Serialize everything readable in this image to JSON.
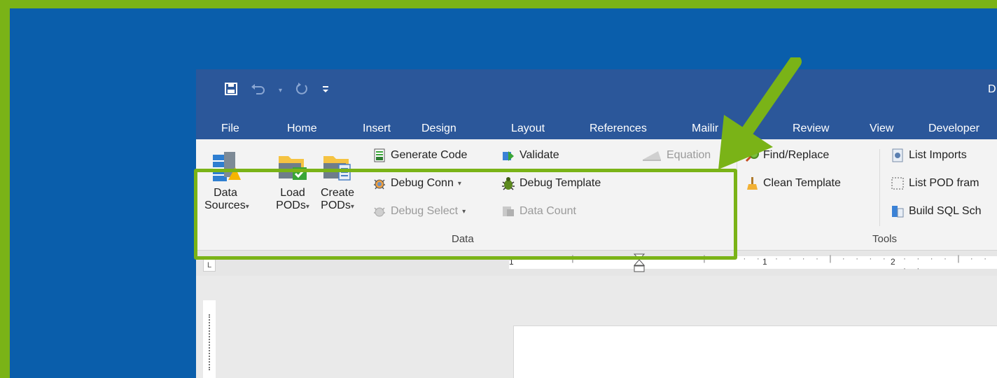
{
  "titlebar": {
    "doc_title_partial": "D"
  },
  "tabs": [
    "File",
    "Home",
    "Insert",
    "Design",
    "Layout",
    "References",
    "Mailir",
    "Review",
    "View",
    "Developer"
  ],
  "ribbon": {
    "data_group": {
      "label": "Data",
      "data_sources": [
        "Data",
        "Sources"
      ],
      "load_pods": [
        "Load",
        "PODs"
      ],
      "create_pods": [
        "Create",
        "PODs"
      ],
      "generate_code": "Generate Code",
      "debug_conn": "Debug Conn",
      "debug_select": "Debug Select",
      "validate": "Validate",
      "debug_template": "Debug Template",
      "data_count": "Data Count",
      "equation": "Equation"
    },
    "tools_group": {
      "label": "Tools",
      "find_replace": "Find/Replace",
      "clean_template": "Clean Template",
      "list_imports": "List Imports",
      "list_pod_fram": "List POD fram",
      "build_sql": "Build SQL Sch"
    }
  },
  "ruler": {
    "mark_1": "1",
    "mark_2": "2",
    "mark_left": "1"
  },
  "icons": [
    "save-icon",
    "undo-icon",
    "redo-icon",
    "customize-qat-icon"
  ],
  "colors": {
    "highlight": "#7ab317",
    "word_blue": "#2b579a",
    "background": "#0a5eab"
  }
}
